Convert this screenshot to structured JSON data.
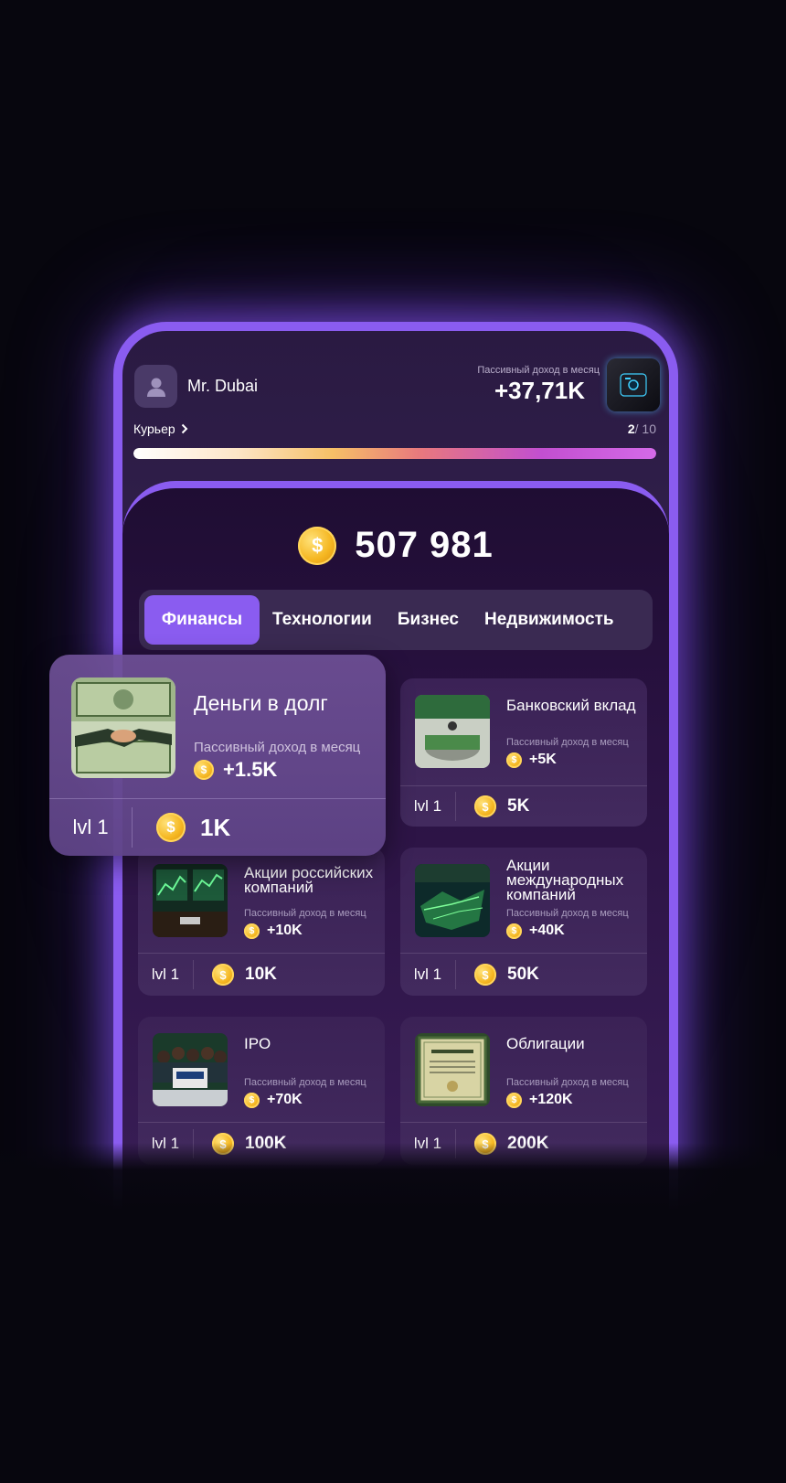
{
  "user": {
    "name": "Mr. Dubai",
    "rank": "Курьер"
  },
  "income": {
    "label": "Пассивный доход в месяц",
    "value": "+37,71K"
  },
  "level": {
    "current": "2",
    "total": "/ 10"
  },
  "progress": {
    "fraction": 1.0
  },
  "balance": "507 981",
  "tabs": [
    {
      "label": "Финансы",
      "active": true
    },
    {
      "label": "Технологии",
      "active": false
    },
    {
      "label": "Бизнес",
      "active": false
    },
    {
      "label": "Недвижимость",
      "active": false
    }
  ],
  "popup": {
    "title": "Деньги в долг",
    "income_label": "Пассивный доход в месяц",
    "income_value": "+1.5K",
    "level": "lvl 1",
    "cost": "1K"
  },
  "cards": [
    {
      "title": "Банковский вклад",
      "income_label": "Пассивный доход в месяц",
      "income_value": "+5K",
      "level": "lvl 1",
      "cost": "5K"
    },
    {
      "title": "Акции российских компаний",
      "income_label": "Пассивный доход в месяц",
      "income_value": "+10K",
      "level": "lvl 1",
      "cost": "10K"
    },
    {
      "title": "Акции международных компаний",
      "income_label": "Пассивный доход в месяц",
      "income_value": "+40K",
      "level": "lvl 1",
      "cost": "50K"
    },
    {
      "title": "IPO",
      "income_label": "Пассивный доход в месяц",
      "income_value": "+70K",
      "level": "lvl 1",
      "cost": "100K"
    },
    {
      "title": "Облигации",
      "income_label": "Пассивный доход в месяц",
      "income_value": "+120K",
      "level": "lvl 1",
      "cost": "200K"
    }
  ],
  "colors": {
    "accent": "#8a5cf0",
    "background": "#07060e",
    "coin": "#f5b722"
  },
  "icons": {
    "avatar": "user-icon",
    "device": "device-icon",
    "coin": "coin-icon",
    "rank_arrow": "chevron-right-icon"
  }
}
